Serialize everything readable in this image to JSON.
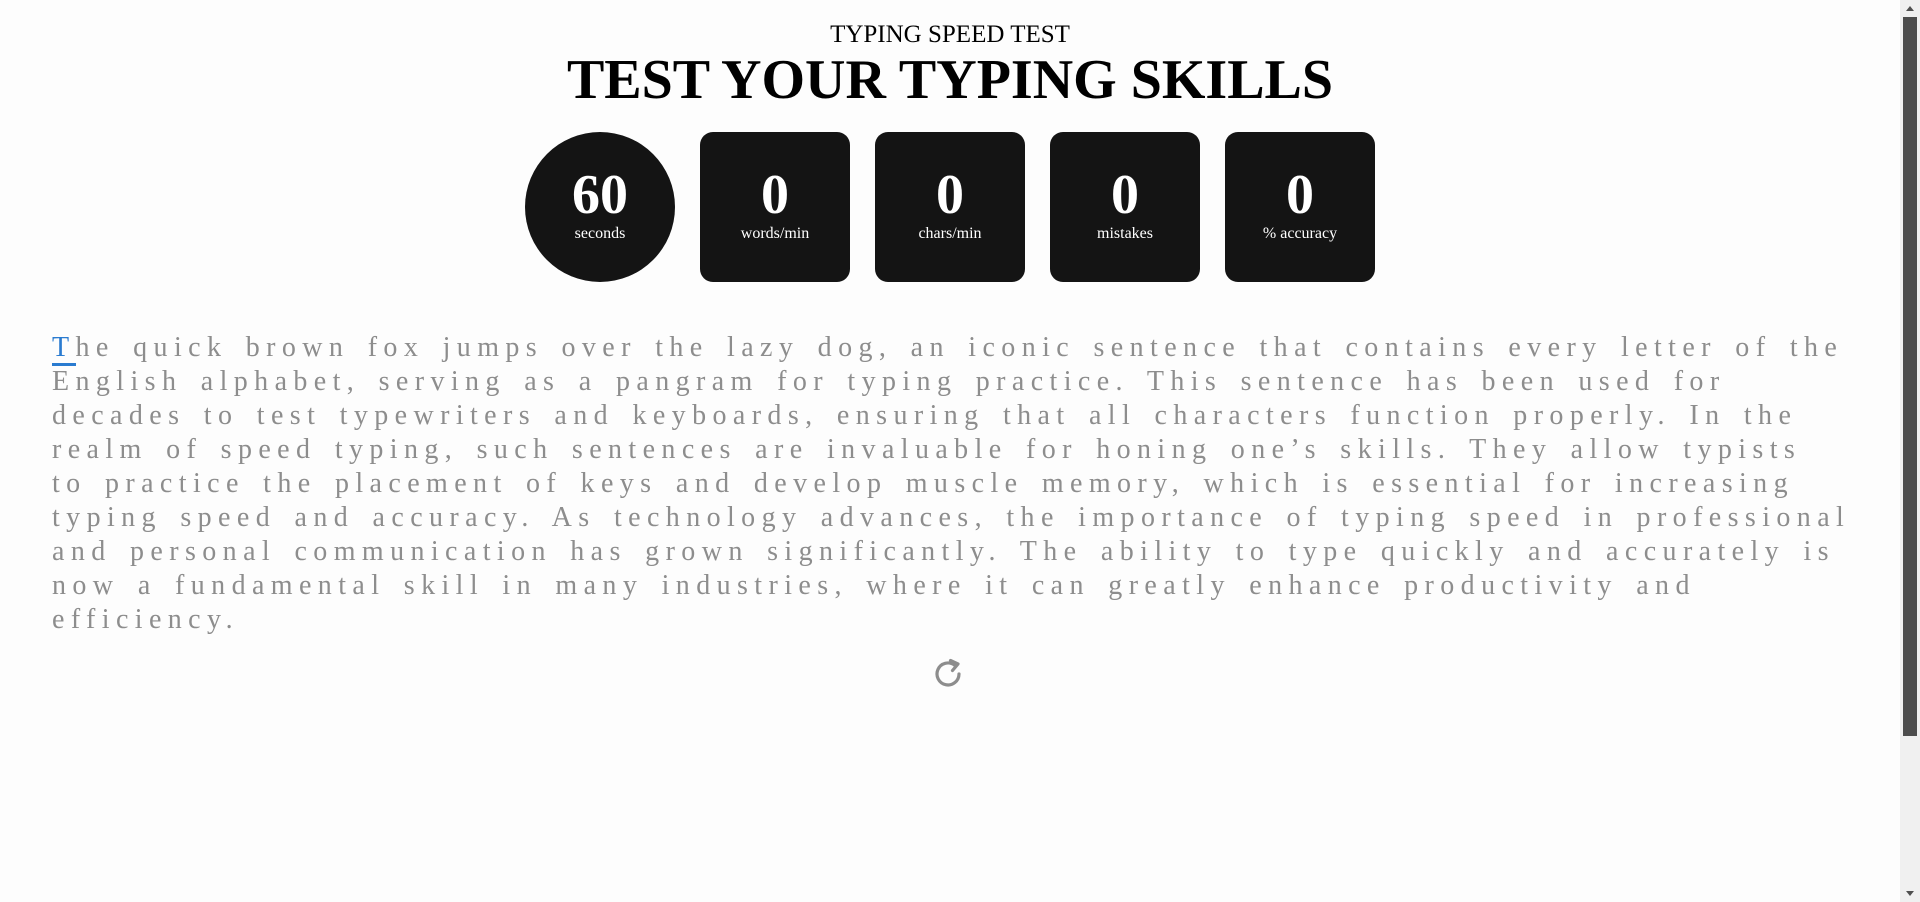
{
  "header": {
    "subtitle": "TYPING SPEED TEST",
    "title": "TEST YOUR TYPING SKILLS"
  },
  "stats": [
    {
      "value": "60",
      "label": "seconds"
    },
    {
      "value": "0",
      "label": "words/min"
    },
    {
      "value": "0",
      "label": "chars/min"
    },
    {
      "value": "0",
      "label": "mistakes"
    },
    {
      "value": "0",
      "label": "% accuracy"
    }
  ],
  "passage": {
    "current_char": "T",
    "remaining": "he quick brown fox jumps over the lazy dog, an iconic sentence that contains every letter of the English alphabet, serving as a pangram for typing practice. This sentence has been used for decades to test typewriters and keyboards, ensuring that all characters function properly. In the realm of speed typing, such sentences are invaluable for honing one’s skills. They allow typists to practice the placement of keys and develop muscle memory, which is essential for increasing typing speed and accuracy. As technology advances, the importance of typing speed in professional and personal communication has grown significantly. The ability to type quickly and accurately is now a fundamental skill in many industries, where it can greatly enhance productivity and efficiency."
  },
  "icons": {
    "reset": "refresh-icon"
  },
  "colors": {
    "stat_bg": "#141414",
    "text_pending": "#8d8d8d",
    "cursor": "#2a7bd0"
  }
}
